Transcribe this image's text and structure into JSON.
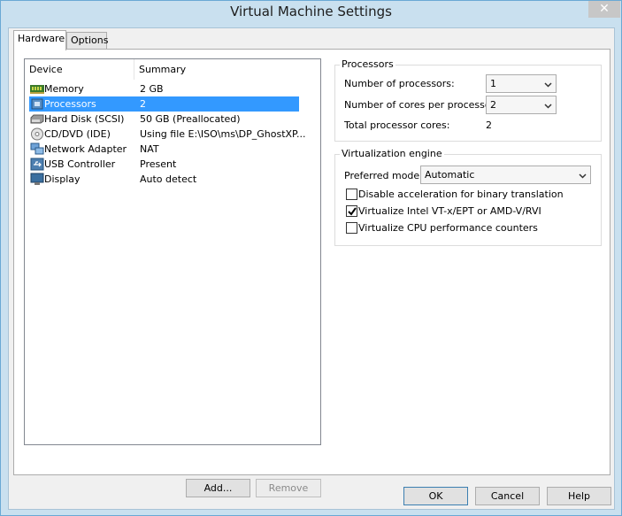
{
  "window": {
    "title": "Virtual Machine Settings",
    "close_label": "✕"
  },
  "tabs": [
    {
      "label": "Hardware",
      "active": true
    },
    {
      "label": "Options",
      "active": false
    }
  ],
  "device_list": {
    "columns": [
      "Device",
      "Summary"
    ],
    "rows": [
      {
        "device": "Memory",
        "summary": "2 GB",
        "icon": "memory-icon",
        "selected": false
      },
      {
        "device": "Processors",
        "summary": "2",
        "icon": "processor-icon",
        "selected": true
      },
      {
        "device": "Hard Disk (SCSI)",
        "summary": "50 GB (Preallocated)",
        "icon": "hard-disk-icon",
        "selected": false
      },
      {
        "device": "CD/DVD (IDE)",
        "summary": "Using file E:\\ISO\\ms\\DP_GhostXP...",
        "icon": "cd-dvd-icon",
        "selected": false
      },
      {
        "device": "Network Adapter",
        "summary": "NAT",
        "icon": "network-adapter-icon",
        "selected": false
      },
      {
        "device": "USB Controller",
        "summary": "Present",
        "icon": "usb-icon",
        "selected": false
      },
      {
        "device": "Display",
        "summary": "Auto detect",
        "icon": "display-icon",
        "selected": false
      }
    ]
  },
  "device_buttons": {
    "add": "Add...",
    "remove": "Remove"
  },
  "processors": {
    "title": "Processors",
    "num_processors_label": "Number of processors:",
    "num_processors_value": "1",
    "cores_label": "Number of cores per processor:",
    "cores_value": "2",
    "total_label": "Total processor cores:",
    "total_value": "2"
  },
  "virtualization": {
    "title": "Virtualization engine",
    "mode_label": "Preferred mode:",
    "mode_value": "Automatic",
    "options": [
      {
        "label": "Disable acceleration for binary translation",
        "checked": false
      },
      {
        "label": "Virtualize Intel VT-x/EPT or AMD-V/RVI",
        "checked": true
      },
      {
        "label": "Virtualize CPU performance counters",
        "checked": false
      }
    ]
  },
  "footer": {
    "ok": "OK",
    "cancel": "Cancel",
    "help": "Help"
  }
}
